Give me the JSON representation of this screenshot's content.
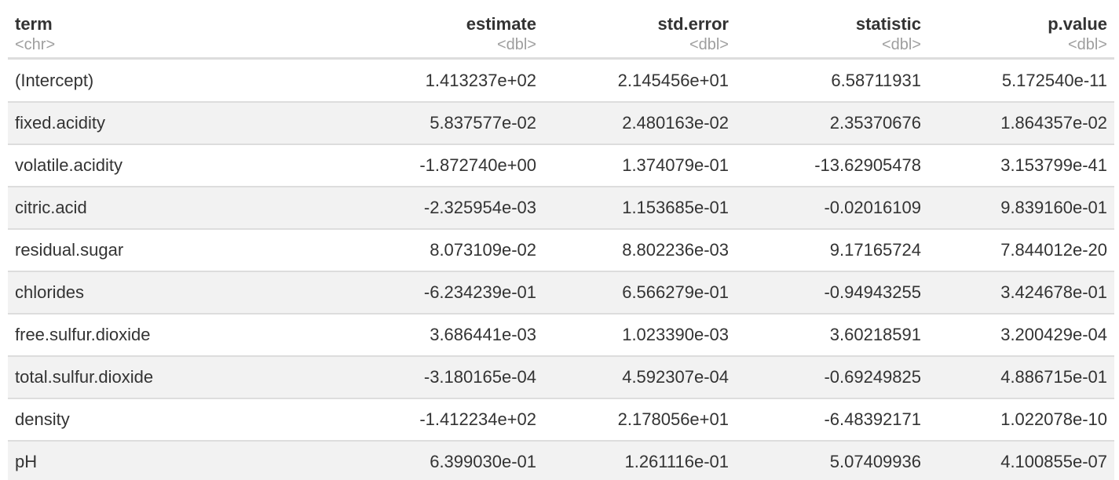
{
  "table": {
    "columns": [
      {
        "name": "term",
        "type": "<chr>",
        "align": "left"
      },
      {
        "name": "estimate",
        "type": "<dbl>",
        "align": "right"
      },
      {
        "name": "std.error",
        "type": "<dbl>",
        "align": "right"
      },
      {
        "name": "statistic",
        "type": "<dbl>",
        "align": "right"
      },
      {
        "name": "p.value",
        "type": "<dbl>",
        "align": "right"
      }
    ],
    "rows": [
      [
        "(Intercept)",
        "1.413237e+02",
        "2.145456e+01",
        "6.58711931",
        "5.172540e-11"
      ],
      [
        "fixed.acidity",
        "5.837577e-02",
        "2.480163e-02",
        "2.35370676",
        "1.864357e-02"
      ],
      [
        "volatile.acidity",
        "-1.872740e+00",
        "1.374079e-01",
        "-13.62905478",
        "3.153799e-41"
      ],
      [
        "citric.acid",
        "-2.325954e-03",
        "1.153685e-01",
        "-0.02016109",
        "9.839160e-01"
      ],
      [
        "residual.sugar",
        "8.073109e-02",
        "8.802236e-03",
        "9.17165724",
        "7.844012e-20"
      ],
      [
        "chlorides",
        "-6.234239e-01",
        "6.566279e-01",
        "-0.94943255",
        "3.424678e-01"
      ],
      [
        "free.sulfur.dioxide",
        "3.686441e-03",
        "1.023390e-03",
        "3.60218591",
        "3.200429e-04"
      ],
      [
        "total.sulfur.dioxide",
        "-3.180165e-04",
        "4.592307e-04",
        "-0.69249825",
        "4.886715e-01"
      ],
      [
        "density",
        "-1.412234e+02",
        "2.178056e+01",
        "-6.48392171",
        "1.022078e-10"
      ],
      [
        "pH",
        "6.399030e-01",
        "1.261116e-01",
        "5.07409936",
        "4.100855e-07"
      ]
    ]
  },
  "colors": {
    "text": "#333333",
    "type_text": "#9e9e9e",
    "stripe": "#f2f2f2",
    "border": "#dddddd"
  }
}
